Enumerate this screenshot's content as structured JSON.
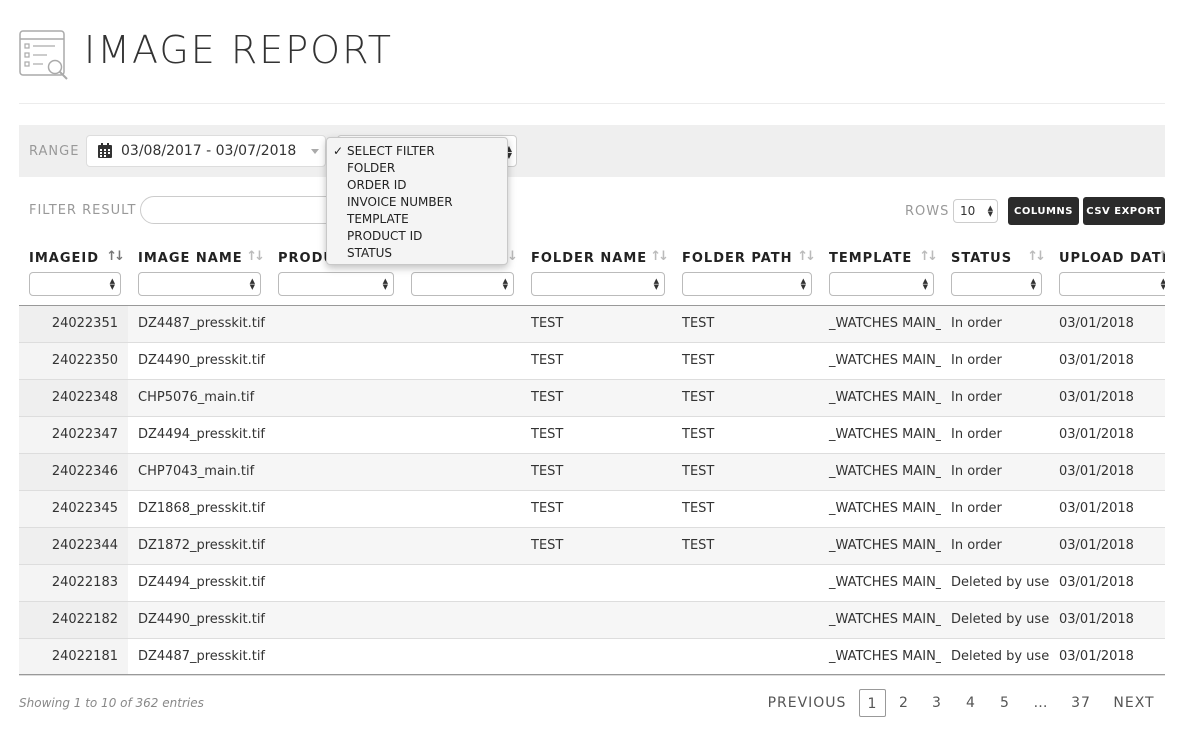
{
  "page": {
    "title": "IMAGE REPORT"
  },
  "range": {
    "label": "RANGE",
    "date_value": "03/08/2017 - 03/07/2018"
  },
  "filter_dropdown": {
    "selected": "SELECT FILTER",
    "options": [
      "SELECT FILTER",
      "FOLDER",
      "ORDER ID",
      "INVOICE NUMBER",
      "TEMPLATE",
      "PRODUCT ID",
      "STATUS"
    ]
  },
  "filter_result": {
    "label": "FILTER RESULT",
    "value": ""
  },
  "rows": {
    "label": "ROWS",
    "value": "10"
  },
  "buttons": {
    "columns": "COLUMNS",
    "csv_export": "CSV EXPORT"
  },
  "table": {
    "columns": [
      "IMAGEID",
      "IMAGE NAME",
      "PRODU",
      "",
      "FOLDER NAME",
      "FOLDER PATH",
      "TEMPLATE",
      "STATUS",
      "UPLOAD DATE"
    ],
    "rows": [
      [
        "24022351",
        "DZ4487_presskit.tif",
        "",
        "",
        "TEST",
        "TEST",
        "_WATCHES MAIN_",
        "In order",
        "03/01/2018"
      ],
      [
        "24022350",
        "DZ4490_presskit.tif",
        "",
        "",
        "TEST",
        "TEST",
        "_WATCHES MAIN_",
        "In order",
        "03/01/2018"
      ],
      [
        "24022348",
        "CHP5076_main.tif",
        "",
        "",
        "TEST",
        "TEST",
        "_WATCHES MAIN_",
        "In order",
        "03/01/2018"
      ],
      [
        "24022347",
        "DZ4494_presskit.tif",
        "",
        "",
        "TEST",
        "TEST",
        "_WATCHES MAIN_",
        "In order",
        "03/01/2018"
      ],
      [
        "24022346",
        "CHP7043_main.tif",
        "",
        "",
        "TEST",
        "TEST",
        "_WATCHES MAIN_",
        "In order",
        "03/01/2018"
      ],
      [
        "24022345",
        "DZ1868_presskit.tif",
        "",
        "",
        "TEST",
        "TEST",
        "_WATCHES MAIN_",
        "In order",
        "03/01/2018"
      ],
      [
        "24022344",
        "DZ1872_presskit.tif",
        "",
        "",
        "TEST",
        "TEST",
        "_WATCHES MAIN_",
        "In order",
        "03/01/2018"
      ],
      [
        "24022183",
        "DZ4494_presskit.tif",
        "",
        "",
        "",
        "",
        "_WATCHES MAIN_",
        "Deleted by user",
        "03/01/2018"
      ],
      [
        "24022182",
        "DZ4490_presskit.tif",
        "",
        "",
        "",
        "",
        "_WATCHES MAIN_",
        "Deleted by user",
        "03/01/2018"
      ],
      [
        "24022181",
        "DZ4487_presskit.tif",
        "",
        "",
        "",
        "",
        "_WATCHES MAIN_",
        "Deleted by user",
        "03/01/2018"
      ]
    ]
  },
  "footer": {
    "entries_info": "Showing 1 to 10 of 362 entries",
    "pagination": {
      "previous": "PREVIOUS",
      "pages": [
        "1",
        "2",
        "3",
        "4",
        "5",
        "…",
        "37"
      ],
      "current": "1",
      "next": "NEXT"
    }
  }
}
